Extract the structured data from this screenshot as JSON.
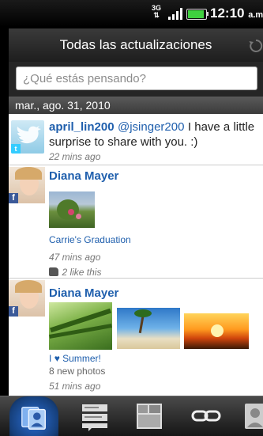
{
  "status_bar": {
    "network": "3G",
    "time": "12:10",
    "ampm": "a.m.",
    "signal_bars": 4,
    "battery_level": 0.85,
    "battery_color": "#3fd13f"
  },
  "header": {
    "title": "Todas las actualizaciones",
    "refresh_icon": "refresh-icon"
  },
  "compose": {
    "placeholder": "¿Qué estás pensando?"
  },
  "date_header": "mar., ago. 31, 2010",
  "feed": [
    {
      "service": "twitter",
      "author": "april_lin200",
      "mention": "@jsinger200",
      "text": "I have a little surprise to share with you. :)",
      "time": "22 mins ago"
    },
    {
      "service": "facebook",
      "author": "Diana Mayer",
      "album": "Carrie's Graduation",
      "time": "47 mins ago",
      "likes": "2 like this"
    },
    {
      "service": "facebook",
      "author": "Diana Mayer",
      "album_prefix": "I",
      "album_heart": "♥",
      "album_suffix": "Summer!",
      "photos": "8 new photos",
      "time": "51 mins ago"
    }
  ],
  "bottom_tabs": [
    {
      "name": "people-tab",
      "icon": "people-icon",
      "active": true
    },
    {
      "name": "messages-tab",
      "icon": "messages-icon",
      "active": false
    },
    {
      "name": "photos-tab",
      "icon": "photos-icon",
      "active": false
    },
    {
      "name": "links-tab",
      "icon": "link-icon",
      "active": false
    },
    {
      "name": "profile-tab",
      "icon": "profile-icon",
      "active": false
    }
  ],
  "colors": {
    "link_blue": "#1f5fad",
    "facebook_blue": "#3b5998",
    "twitter_blue": "#33ccff",
    "active_tab": "#2b6fd6"
  }
}
